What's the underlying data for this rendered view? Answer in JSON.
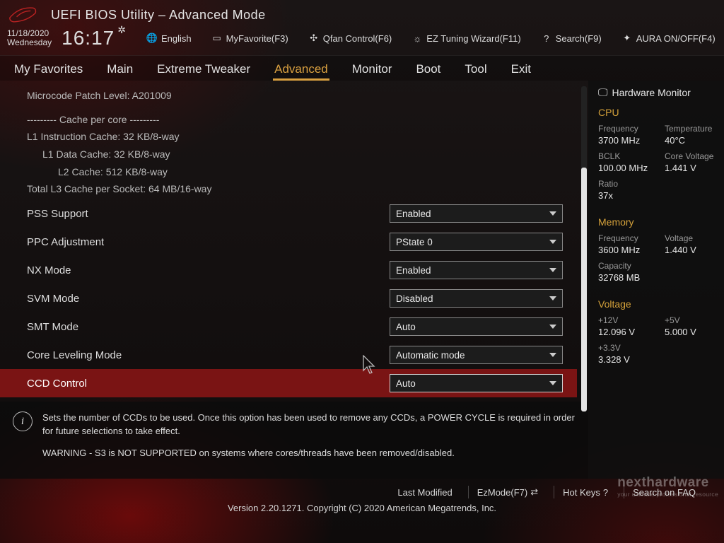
{
  "app": {
    "title": "UEFI BIOS Utility – Advanced Mode"
  },
  "toolbar": {
    "date": "11/18/2020",
    "weekday": "Wednesday",
    "time": "16:17",
    "language": "English",
    "favorite": "MyFavorite(F3)",
    "qfan": "Qfan Control(F6)",
    "eztune": "EZ Tuning Wizard(F11)",
    "search": "Search(F9)",
    "aura": "AURA ON/OFF(F4)"
  },
  "tabs": {
    "favorites": "My Favorites",
    "main": "Main",
    "tweaker": "Extreme Tweaker",
    "advanced": "Advanced",
    "monitor": "Monitor",
    "boot": "Boot",
    "tool": "Tool",
    "exit": "Exit"
  },
  "info": {
    "microcode": "Microcode Patch Level: A201009",
    "cache_header": "--------- Cache per core ---------",
    "l1i": "L1 Instruction Cache: 32 KB/8-way",
    "l1d": "L1 Data Cache: 32 KB/8-way",
    "l2": "L2 Cache: 512 KB/8-way",
    "l3": "Total L3 Cache per Socket: 64 MB/16-way"
  },
  "options": {
    "pss": {
      "label": "PSS Support",
      "value": "Enabled"
    },
    "ppc": {
      "label": "PPC Adjustment",
      "value": "PState 0"
    },
    "nx": {
      "label": "NX Mode",
      "value": "Enabled"
    },
    "svm": {
      "label": "SVM Mode",
      "value": "Disabled"
    },
    "smt": {
      "label": "SMT Mode",
      "value": "Auto"
    },
    "corelvl": {
      "label": "Core Leveling Mode",
      "value": "Automatic mode"
    },
    "ccd": {
      "label": "CCD Control",
      "value": "Auto"
    }
  },
  "help": {
    "body": "Sets the number of CCDs to be used. Once this option has been used to remove any CCDs, a POWER CYCLE is required in order for future selections to take effect.",
    "warn": "WARNING - S3 is NOT SUPPORTED on systems where cores/threads have been removed/disabled."
  },
  "sidebar": {
    "title": "Hardware Monitor",
    "cpu": {
      "label": "CPU",
      "freq_l": "Frequency",
      "freq_v": "3700 MHz",
      "temp_l": "Temperature",
      "temp_v": "40°C",
      "bclk_l": "BCLK",
      "bclk_v": "100.00 MHz",
      "cv_l": "Core Voltage",
      "cv_v": "1.441 V",
      "ratio_l": "Ratio",
      "ratio_v": "37x"
    },
    "mem": {
      "label": "Memory",
      "freq_l": "Frequency",
      "freq_v": "3600 MHz",
      "volt_l": "Voltage",
      "volt_v": "1.440 V",
      "cap_l": "Capacity",
      "cap_v": "32768 MB"
    },
    "volt": {
      "label": "Voltage",
      "p12_l": "+12V",
      "p12_v": "12.096 V",
      "p5_l": "+5V",
      "p5_v": "5.000 V",
      "p33_l": "+3.3V",
      "p33_v": "3.328 V"
    }
  },
  "footer": {
    "lastmod": "Last Modified",
    "ezmode": "EzMode(F7)",
    "hotkeys": "Hot Keys",
    "faq": "Search on FAQ",
    "version": "Version 2.20.1271. Copyright (C) 2020 American Megatrends, Inc."
  },
  "watermark": {
    "main": "nexthardware",
    "sub": "your ultimate professional resource"
  }
}
